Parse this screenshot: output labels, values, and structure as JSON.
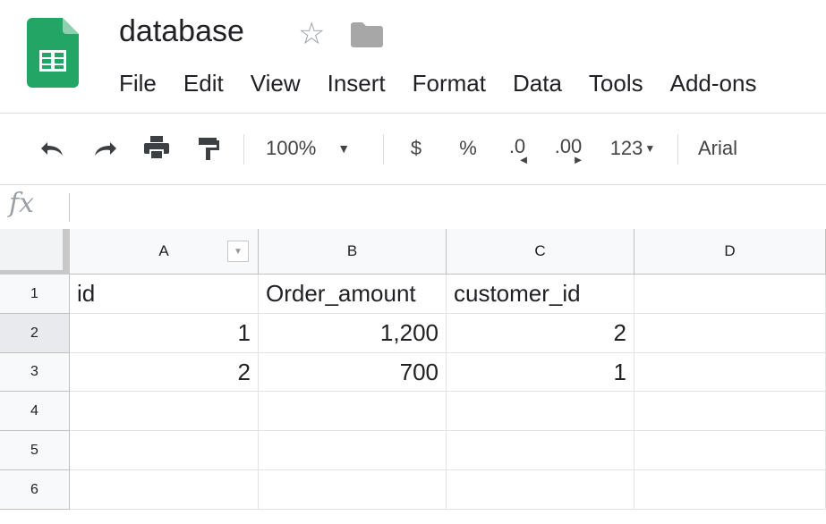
{
  "app": {
    "doc_title": "database"
  },
  "menu": [
    "File",
    "Edit",
    "View",
    "Insert",
    "Format",
    "Data",
    "Tools",
    "Add-ons"
  ],
  "toolbar": {
    "zoom": "100%",
    "currency": "$",
    "percent": "%",
    "decrease_decimals": ".0",
    "increase_decimals": ".00",
    "more_formats": "123",
    "font": "Arial"
  },
  "formula_bar": {
    "fx_label": "fx"
  },
  "columns": [
    "A",
    "B",
    "C",
    "D"
  ],
  "rows": [
    "1",
    "2",
    "3",
    "4",
    "5",
    "6"
  ],
  "cells": {
    "A1": "id",
    "B1": "Order_amount",
    "C1": "customer_id",
    "A2": "1",
    "B2": "1,200",
    "C2": "2",
    "A3": "2",
    "B3": "700",
    "C3": "1"
  },
  "colors": {
    "sheets_green": "#23A566",
    "header_bg": "#f8f9fa",
    "gridline": "#e2e3e3"
  }
}
